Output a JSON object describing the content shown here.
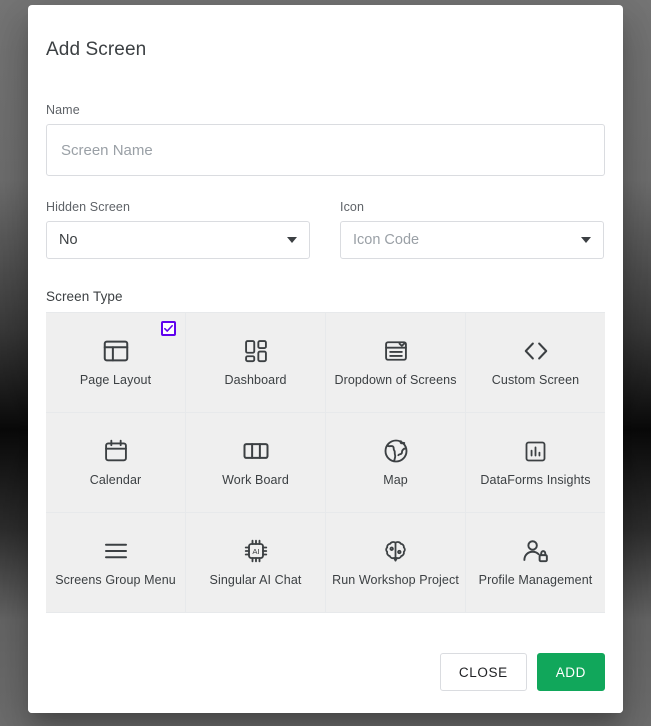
{
  "dialog": {
    "title": "Add Screen",
    "name_field": {
      "label": "Name",
      "value": "",
      "placeholder": "Screen Name"
    },
    "hidden_screen": {
      "label": "Hidden Screen",
      "value": "No",
      "icon": "chevron-down-icon"
    },
    "icon_field": {
      "label": "Icon",
      "value": "",
      "placeholder": "Icon Code",
      "icon": "chevron-down-icon"
    },
    "screen_type": {
      "label": "Screen Type",
      "tiles": [
        {
          "label": "Page Layout",
          "icon": "page-layout-icon",
          "selected": true
        },
        {
          "label": "Dashboard",
          "icon": "dashboard-icon",
          "selected": false
        },
        {
          "label": "Dropdown of Screens",
          "icon": "dropdown-of-screens-icon",
          "selected": false
        },
        {
          "label": "Custom Screen",
          "icon": "code-brackets-icon",
          "selected": false
        },
        {
          "label": "Calendar",
          "icon": "calendar-icon",
          "selected": false
        },
        {
          "label": "Work Board",
          "icon": "work-board-icon",
          "selected": false
        },
        {
          "label": "Map",
          "icon": "globe-icon",
          "selected": false
        },
        {
          "label": "DataForms Insights",
          "icon": "bar-chart-icon",
          "selected": false
        },
        {
          "label": "Screens Group Menu",
          "icon": "hamburger-menu-icon",
          "selected": false
        },
        {
          "label": "Singular AI Chat",
          "icon": "ai-chip-icon",
          "selected": false
        },
        {
          "label": "Run Workshop Project",
          "icon": "brain-icon",
          "selected": false
        },
        {
          "label": "Profile Management",
          "icon": "person-lock-icon",
          "selected": false
        }
      ]
    },
    "footer": {
      "close_label": "CLOSE",
      "add_label": "ADD"
    }
  },
  "colors": {
    "accent_checkbox": "#6002ee",
    "primary_action": "#11a75b",
    "tile_background": "#efefef",
    "text": "#3c4043",
    "muted_text": "#5f6368",
    "placeholder": "#9aa0a6",
    "border": "#dadce0",
    "backdrop": "#6e6e6e"
  }
}
